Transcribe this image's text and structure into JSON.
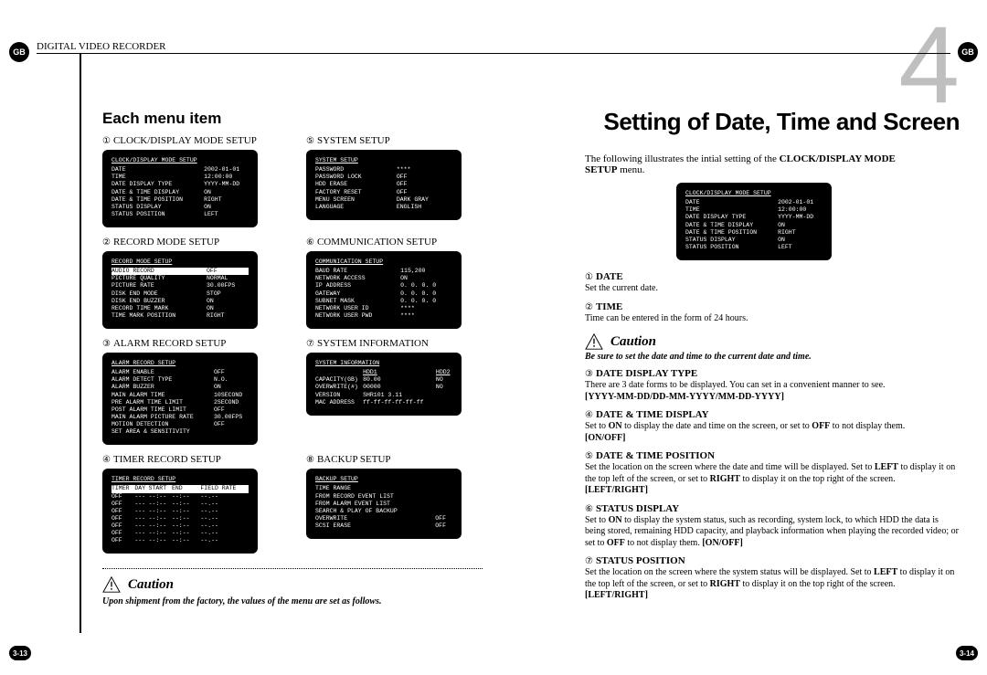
{
  "header": {
    "lang_badge": "GB",
    "title": "DIGITAL VIDEO RECORDER"
  },
  "page_numbers": {
    "left": "3-13",
    "right": "3-14"
  },
  "chapter": {
    "big_number": "4",
    "title": "Setting of Date, Time and Screen"
  },
  "left_page": {
    "heading": "Each menu item",
    "caution_label": "Caution",
    "caution_body": "Upon shipment from the factory, the values of the menu are set as follows.",
    "menus": [
      {
        "num": "①",
        "label": "CLOCK/DISPLAY MODE SETUP",
        "osd_title": "CLOCK/DISPLAY MODE SETUP",
        "rows": [
          [
            "DATE",
            "2002-01-01"
          ],
          [
            "TIME",
            "12:00:00"
          ],
          [
            "DATE DISPLAY TYPE",
            "YYYY-MM-DD"
          ],
          [
            "DATE & TIME DISPLAY",
            "ON"
          ],
          [
            "DATE & TIME POSITION",
            "RIGHT"
          ],
          [
            "STATUS DISPLAY",
            "ON"
          ],
          [
            "STATUS POSITION",
            "LEFT"
          ]
        ]
      },
      {
        "num": "⑤",
        "label": "SYSTEM SETUP",
        "osd_title": "SYSTEM SETUP",
        "rows": [
          [
            "PASSWORD",
            "****"
          ],
          [
            "PASSWORD LOCK",
            "OFF"
          ],
          [
            "HDD ERASE",
            "OFF"
          ],
          [
            "FACTORY RESET",
            "OFF"
          ],
          [
            "MENU SCREEN",
            "DARK GRAY"
          ],
          [
            "LANGUAGE",
            "ENGLISH"
          ]
        ]
      },
      {
        "num": "②",
        "label": "RECORD MODE SETUP",
        "osd_title": "RECORD MODE SETUP",
        "invert_first": true,
        "rows": [
          [
            "AUDIO RECORD",
            "OFF"
          ],
          [
            "PICTURE QUALITY",
            "NORMAL"
          ],
          [
            "PICTURE RATE",
            "30.00FPS"
          ],
          [
            "DISK END MODE",
            "STOP"
          ],
          [
            "DISK END BUZZER",
            "ON"
          ],
          [
            "RECORD TIME MARK",
            "ON"
          ],
          [
            "TIME MARK POSITION",
            "RIGHT"
          ]
        ]
      },
      {
        "num": "⑥",
        "label": "COMMUNICATION SETUP",
        "osd_title": "COMMUNICATION SETUP",
        "rows": [
          [
            "BAUD RATE",
            "115,200"
          ],
          [
            "NETWORK ACCESS",
            "ON"
          ],
          [
            "IP ADDRESS",
            "0. 0. 0. 0"
          ],
          [
            "GATEWAY",
            "0. 0. 0. 0"
          ],
          [
            "SUBNET MASK",
            "0. 0. 0. 0"
          ],
          [
            "NETWORK USER ID",
            "****"
          ],
          [
            "NETWORK USER PWD",
            "****"
          ]
        ]
      },
      {
        "num": "③",
        "label": "ALARM RECORD SETUP",
        "osd_title": "ALARM RECORD SETUP",
        "rows": [
          [
            "ALARM ENABLE",
            "OFF"
          ],
          [
            "ALARM DETECT TYPE",
            "N.O."
          ],
          [
            "ALARM BUZZER",
            "ON"
          ],
          [
            "MAIN ALARM TIME",
            "10SECOND"
          ],
          [
            "PRE ALARM TIME LIMIT",
            "2SECOND"
          ],
          [
            "POST ALARM TIME LIMIT",
            "OFF"
          ],
          [
            "MAIN ALARM PICTURE RATE",
            "30.00FPS"
          ],
          [
            "MOTION DETECTION",
            "OFF"
          ],
          [
            "SET AREA & SENSITIVITY",
            ""
          ]
        ]
      },
      {
        "num": "⑦",
        "label": "SYSTEM INFORMATION",
        "osd_title": "SYSTEM INFORMATION",
        "is_sysinfo": true,
        "sys_headers": [
          "",
          "HDD1",
          "HDD2"
        ],
        "sys_rows": [
          [
            "CAPACITY(GB)",
            "80.00",
            "NO"
          ],
          [
            "OVERWRITE(#)",
            "00000",
            "NO"
          ],
          [
            "VERSION",
            "SHR101 3.11",
            ""
          ],
          [
            "MAC ADDRESS",
            "ff-ff-ff-ff-ff-ff",
            ""
          ]
        ]
      },
      {
        "num": "④",
        "label": "TIMER RECORD SETUP",
        "osd_title": "TIMER RECORD SETUP",
        "is_timer": true,
        "timer_headers": [
          "TIMER",
          "DAY",
          "START",
          "END",
          "FIELD RATE"
        ],
        "timer_rows": [
          [
            "OFF",
            "---",
            "--:--",
            "--:--",
            "--.--"
          ],
          [
            "OFF",
            "---",
            "--:--",
            "--:--",
            "--.--"
          ],
          [
            "OFF",
            "---",
            "--:--",
            "--:--",
            "--.--"
          ],
          [
            "OFF",
            "---",
            "--:--",
            "--:--",
            "--.--"
          ],
          [
            "OFF",
            "---",
            "--:--",
            "--:--",
            "--.--"
          ],
          [
            "OFF",
            "---",
            "--:--",
            "--:--",
            "--.--"
          ],
          [
            "OFF",
            "---",
            "--:--",
            "--:--",
            "--.--"
          ]
        ]
      },
      {
        "num": "⑧",
        "label": "BACKUP SETUP",
        "osd_title": "BACKUP SETUP",
        "rows": [
          [
            "TIME RANGE",
            ""
          ],
          [
            "FROM RECORD EVENT LIST",
            ""
          ],
          [
            "FROM ALARM EVENT LIST",
            ""
          ],
          [
            "SEARCH & PLAY OF BACKUP",
            ""
          ],
          [
            "OVERWRITE",
            "OFF"
          ],
          [
            "SCSI ERASE",
            "OFF"
          ]
        ]
      }
    ]
  },
  "right_page": {
    "intro_pre": "The following illustrates the intial setting of the ",
    "intro_bold": "CLOCK/DISPLAY MODE SETUP",
    "intro_post": " menu.",
    "osd_title": "CLOCK/DISPLAY MODE SETUP",
    "osd_rows": [
      [
        "DATE",
        "2002-01-01"
      ],
      [
        "TIME",
        "12:00:00"
      ],
      [
        "DATE DISPLAY TYPE",
        "YYYY-MM-DD"
      ],
      [
        "DATE & TIME DISPLAY",
        "ON"
      ],
      [
        "DATE & TIME POSITION",
        "RIGHT"
      ],
      [
        "STATUS DISPLAY",
        "ON"
      ],
      [
        "STATUS POSITION",
        "LEFT"
      ]
    ],
    "caution_label": "Caution",
    "caution_body": "Be sure to set the date and time to the current date and time.",
    "items": [
      {
        "num": "①",
        "title": "DATE",
        "body": "Set the current date."
      },
      {
        "num": "②",
        "title": "TIME",
        "body": "Time can be entered in the form of 24 hours."
      },
      {
        "num": "③",
        "title": "DATE DISPLAY TYPE",
        "body": "There are 3 date forms to be displayed. You can set in a convenient manner to see.",
        "opt": "[YYYY-MM-DD/DD-MM-YYYY/MM-DD-YYYY]"
      },
      {
        "num": "④",
        "title": "DATE & TIME DISPLAY",
        "body_html": "Set to <b>ON</b> to display the date and time on the screen, or set to <b>OFF</b> to not display them.",
        "opt": "[ON/OFF]"
      },
      {
        "num": "⑤",
        "title": "DATE & TIME POSITION",
        "body_html": "Set the location on the screen where the date and time will be displayed. Set to <b>LEFT</b> to display it on the top left of the screen, or set to <b>RIGHT</b> to display it on the top right of the screen. <b>[LEFT/RIGHT]</b>"
      },
      {
        "num": "⑥",
        "title": "STATUS DISPLAY",
        "body_html": "Set to <b>ON</b> to display the system status, such as recording, system lock, to which HDD the data is being stored, remaining HDD capacity, and playback information when playing the recorded video; or set to <b>OFF</b> to not display them. <b>[ON/OFF]</b>"
      },
      {
        "num": "⑦",
        "title": "STATUS POSITION",
        "body_html": "Set the location on the screen where the system status will be displayed. Set to <b>LEFT</b> to display it on the top left of the screen, or set to <b>RIGHT</b> to display it on the top right of the screen. <b>[LEFT/RIGHT]</b>"
      }
    ]
  }
}
